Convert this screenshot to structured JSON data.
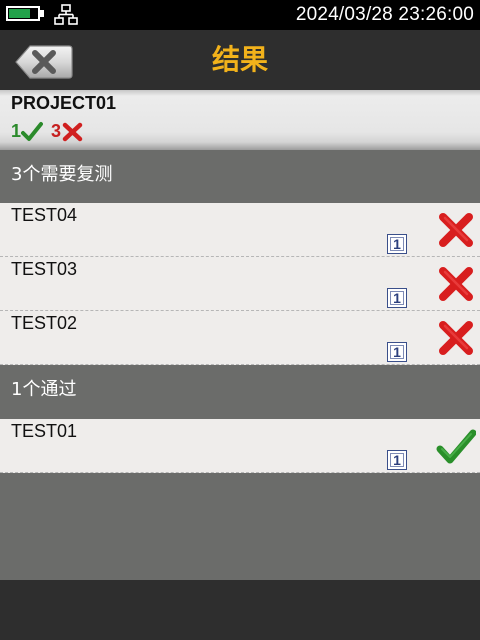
{
  "status_bar": {
    "datetime": "2024/03/28  23:26:00",
    "battery_icon": "battery-icon",
    "network_icon": "network-icon",
    "battery_color": "#22a24a"
  },
  "header": {
    "title": "结果",
    "back_icon": "back-delete-icon",
    "title_color": "#f2b21b"
  },
  "project": {
    "name": "PROJECT01",
    "pass_count": "1",
    "fail_count": "3",
    "pass_color": "#2b8a2b",
    "fail_color": "#c62020"
  },
  "sections": [
    {
      "title": "3个需要复测",
      "items": [
        {
          "name": "TEST04",
          "badge": "1",
          "status": "fail"
        },
        {
          "name": "TEST03",
          "badge": "1",
          "status": "fail"
        },
        {
          "name": "TEST02",
          "badge": "1",
          "status": "fail"
        }
      ]
    },
    {
      "title": "1个通过",
      "items": [
        {
          "name": "TEST01",
          "badge": "1",
          "status": "pass"
        }
      ]
    }
  ]
}
